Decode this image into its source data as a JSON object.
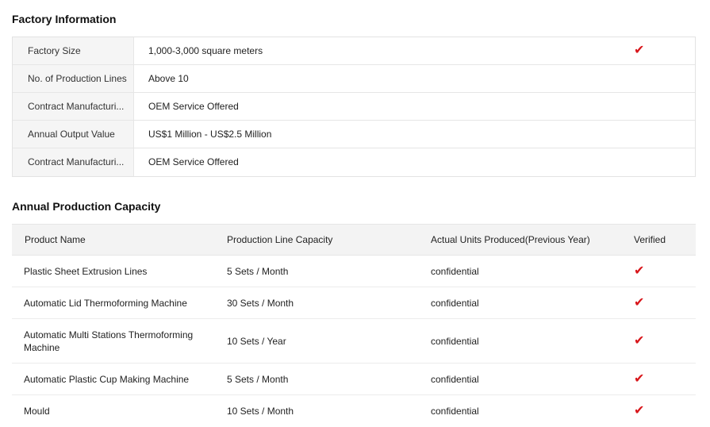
{
  "factory": {
    "title": "Factory Information",
    "rows": [
      {
        "label": "Factory Size",
        "value": "1,000-3,000 square meters",
        "verified": true
      },
      {
        "label": "No. of Production Lines",
        "value": "Above 10",
        "verified": false
      },
      {
        "label": "Contract Manufacturi...",
        "value": "OEM Service Offered",
        "verified": false
      },
      {
        "label": "Annual Output Value",
        "value": "US$1 Million - US$2.5 Million",
        "verified": false
      },
      {
        "label": "Contract Manufacturi...",
        "value": "OEM Service Offered",
        "verified": false
      }
    ]
  },
  "capacity": {
    "title": "Annual Production Capacity",
    "headers": {
      "product": "Product Name",
      "line_capacity": "Production Line Capacity",
      "actual_units": "Actual Units Produced(Previous Year)",
      "verified": "Verified"
    },
    "rows": [
      {
        "product": "Plastic Sheet Extrusion Lines",
        "capacity": "5 Sets / Month",
        "actual": "confidential",
        "verified": true
      },
      {
        "product": "Automatic Lid Thermoforming Machine",
        "capacity": "30 Sets / Month",
        "actual": "confidential",
        "verified": true
      },
      {
        "product": "Automatic Multi Stations Thermoforming Machine",
        "capacity": "10 Sets / Year",
        "actual": "confidential",
        "verified": true
      },
      {
        "product": "Automatic Plastic Cup Making Machine",
        "capacity": "5 Sets / Month",
        "actual": "confidential",
        "verified": true
      },
      {
        "product": "Mould",
        "capacity": "10 Sets / Month",
        "actual": "confidential",
        "verified": true
      }
    ]
  },
  "icons": {
    "check": "✔"
  },
  "colors": {
    "check": "#d8161b",
    "label_bg": "#f5f5f5",
    "header_bg": "#f3f3f3"
  }
}
